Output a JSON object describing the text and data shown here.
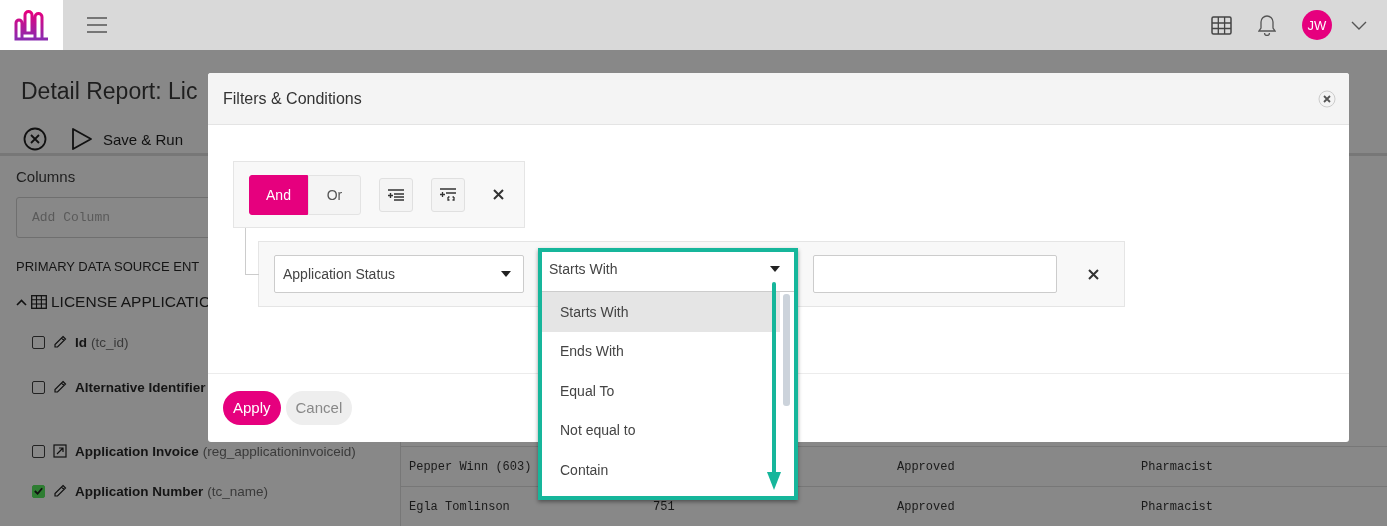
{
  "topbar": {
    "avatar": "JW"
  },
  "page": {
    "title": "Detail Report: Lic",
    "run_label": "Save & Run"
  },
  "sidebar": {
    "heading": "Columns",
    "search_placeholder": "Add Column",
    "section": "PRIMARY DATA SOURCE ENT",
    "entity": "LICENSE APPLICATIO",
    "columns": [
      {
        "label": "Id",
        "field": "(tc_id)",
        "checked": false,
        "kind": "edit"
      },
      {
        "label": "Alternative Identifier",
        "checked": false,
        "kind": "edit"
      },
      {
        "label": "Application Invoice",
        "field": "(reg_applicationinvoiceid)",
        "checked": false,
        "kind": "link"
      },
      {
        "label": "Application Number",
        "field": "(tc_name)",
        "checked": true,
        "kind": "edit"
      }
    ]
  },
  "table": {
    "rows": [
      [
        "Pepper Winn (603)",
        "",
        "Approved",
        "Pharmacist"
      ],
      [
        "Egla Tomlinson",
        "751",
        "Approved",
        "Pharmacist"
      ]
    ]
  },
  "modal": {
    "title": "Filters & Conditions",
    "logic": [
      {
        "label": "And",
        "selected": true
      },
      {
        "label": "Or",
        "selected": false
      }
    ],
    "condition": {
      "field": "Application Status",
      "operator": "Starts With"
    },
    "options": [
      {
        "label": "Starts With",
        "selected": true
      },
      {
        "label": "Ends With",
        "selected": false
      },
      {
        "label": "Equal To",
        "selected": false
      },
      {
        "label": "Not equal to",
        "selected": false
      },
      {
        "label": "Contain",
        "selected": false
      }
    ],
    "buttons": [
      {
        "label": "Apply",
        "kind": "primary"
      },
      {
        "label": "Cancel",
        "kind": "secondary"
      }
    ]
  }
}
